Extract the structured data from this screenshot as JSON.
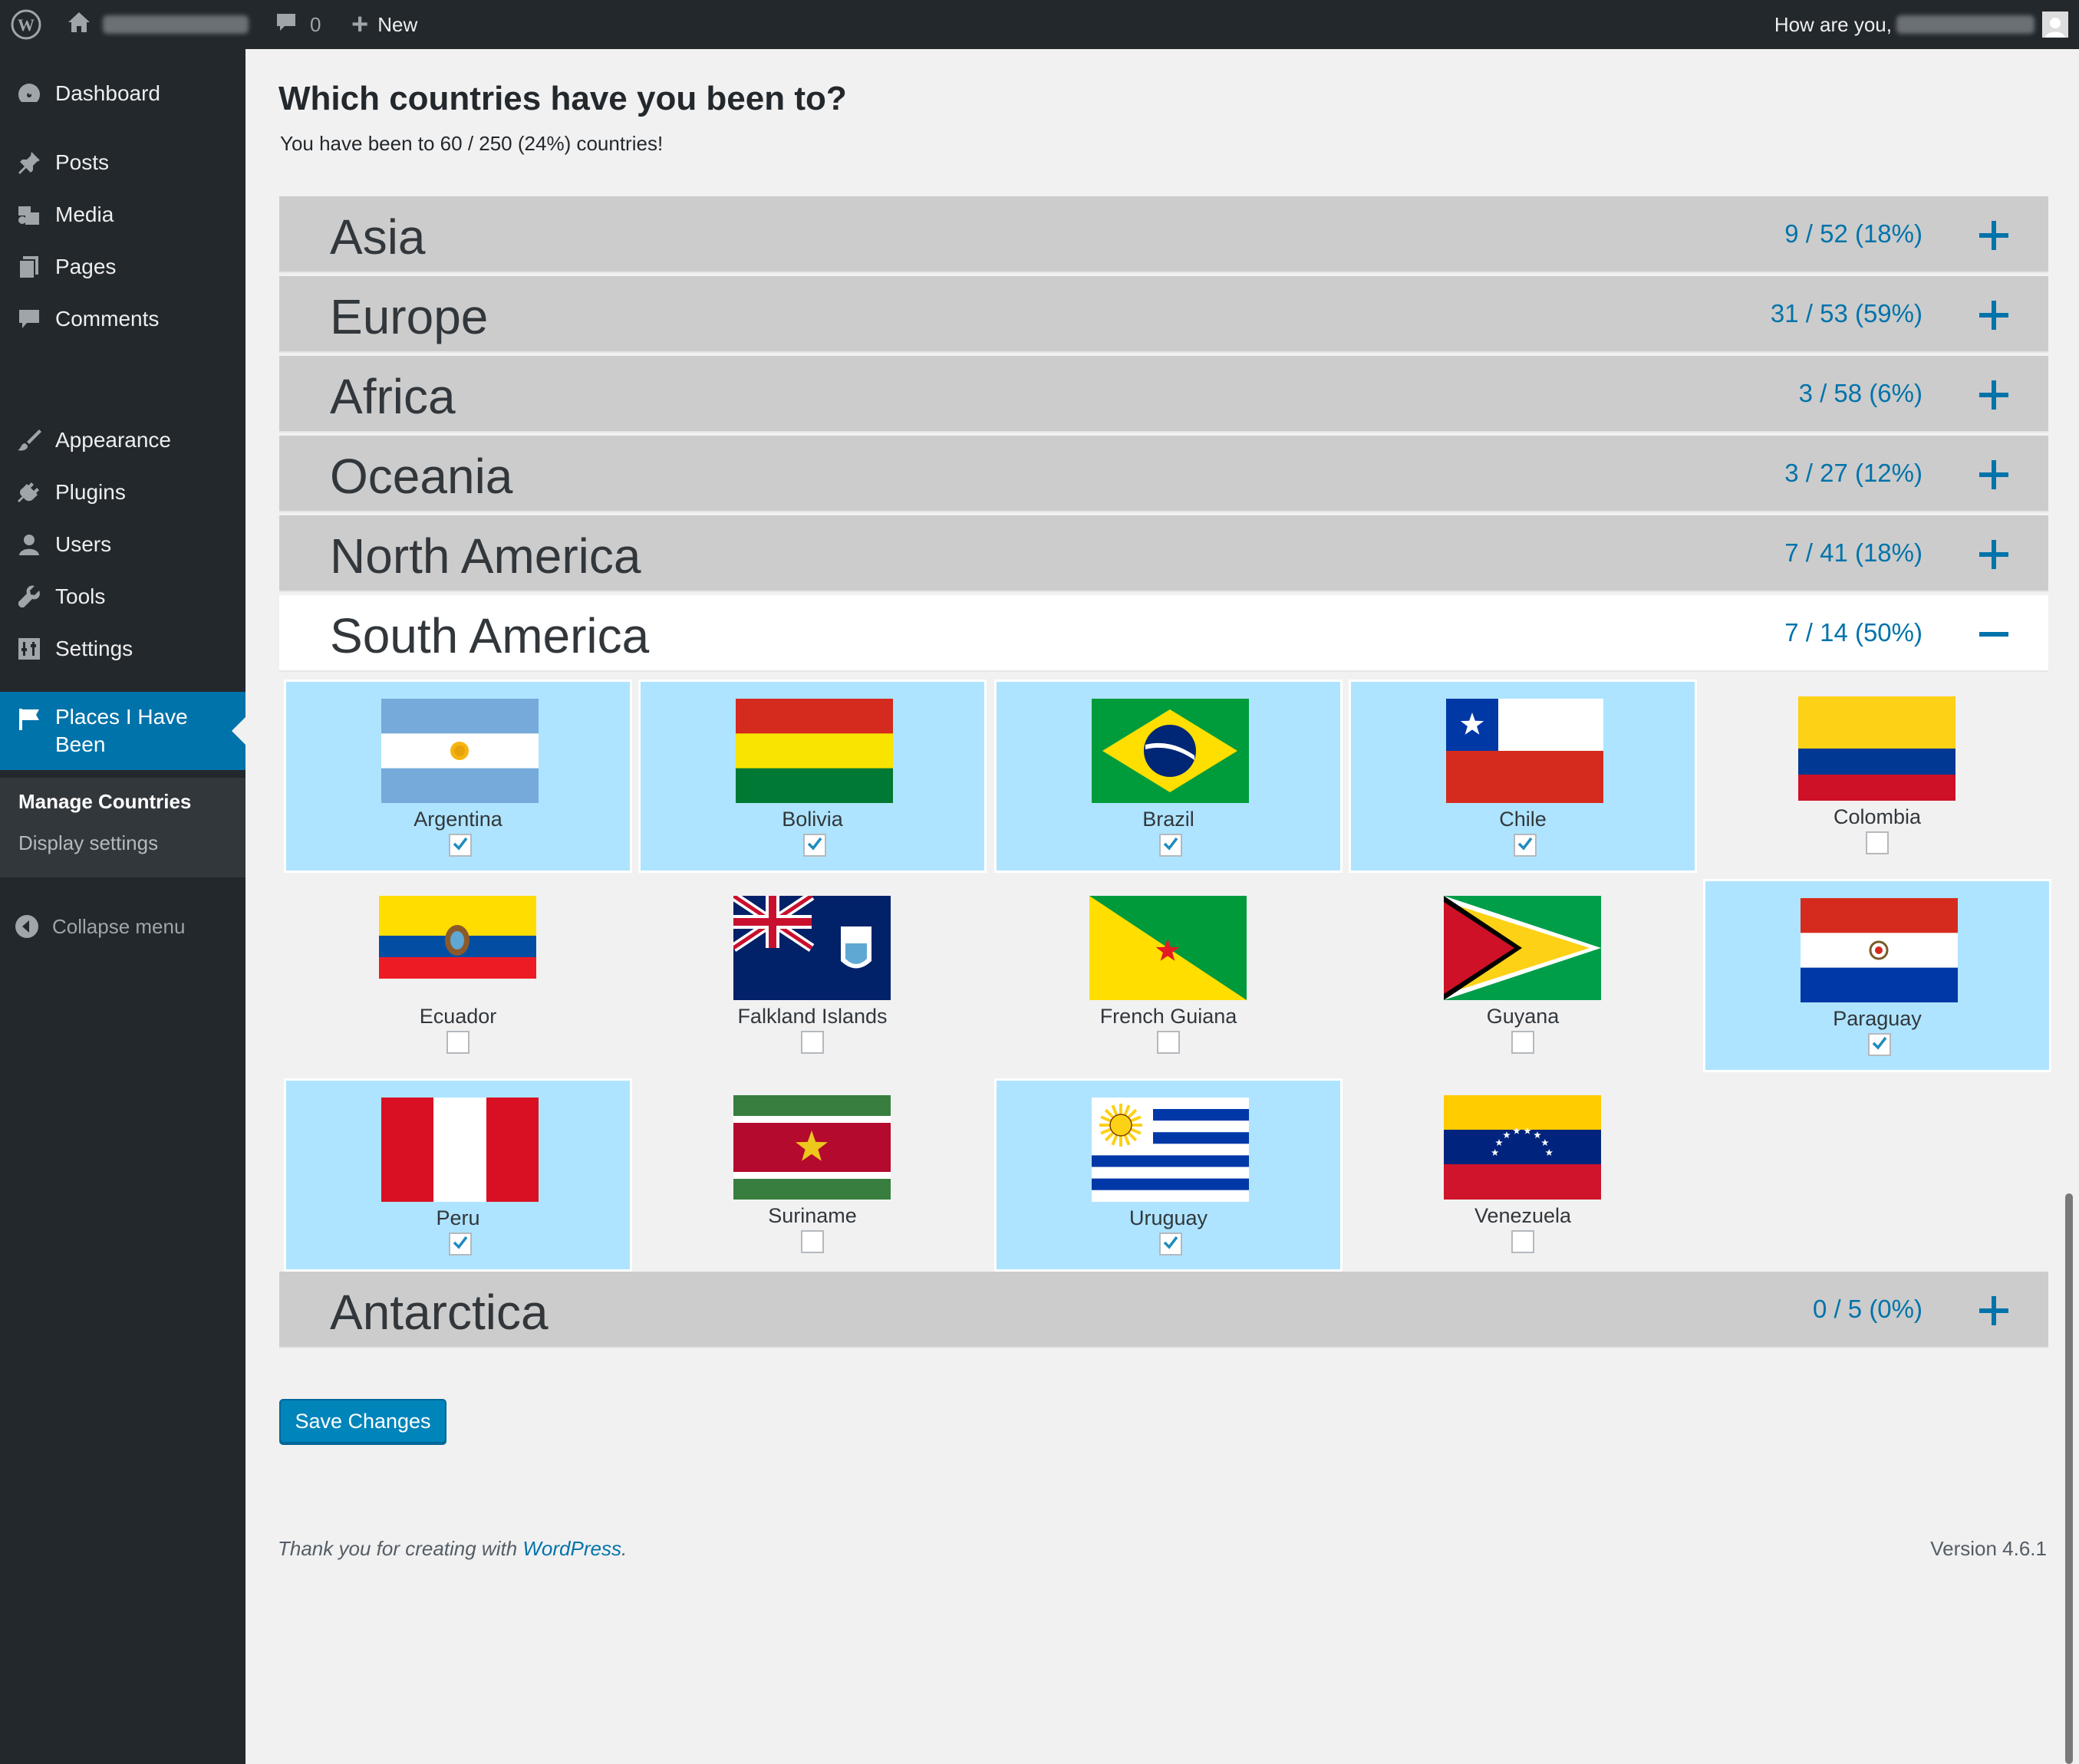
{
  "adminbar": {
    "comments_count": "0",
    "new_label": "New",
    "greeting": "How are you,"
  },
  "sidebar": {
    "items": [
      {
        "label": "Dashboard",
        "icon": "dashboard-icon"
      },
      {
        "label": "Posts",
        "icon": "pin-icon"
      },
      {
        "label": "Media",
        "icon": "media-icon"
      },
      {
        "label": "Pages",
        "icon": "pages-icon"
      },
      {
        "label": "Comments",
        "icon": "comment-icon"
      },
      {
        "label": "Appearance",
        "icon": "brush-icon"
      },
      {
        "label": "Plugins",
        "icon": "plug-icon"
      },
      {
        "label": "Users",
        "icon": "user-icon"
      },
      {
        "label": "Tools",
        "icon": "wrench-icon"
      },
      {
        "label": "Settings",
        "icon": "settings-icon"
      }
    ],
    "current": {
      "label_line1": "Places I Have",
      "label_line2": "Been",
      "icon": "flag-icon"
    },
    "submenu": [
      "Manage Countries",
      "Display settings"
    ],
    "collapse_label": "Collapse menu"
  },
  "main": {
    "title": "Which countries have you been to?",
    "summary": "You have been to 60 / 250 (24%) countries!",
    "continents": [
      {
        "name": "Asia",
        "count": "9 / 52 (18%)",
        "open": false
      },
      {
        "name": "Europe",
        "count": "31 / 53 (59%)",
        "open": false
      },
      {
        "name": "Africa",
        "count": "3 / 58 (6%)",
        "open": false
      },
      {
        "name": "Oceania",
        "count": "3 / 27 (12%)",
        "open": false
      },
      {
        "name": "North America",
        "count": "7 / 41 (18%)",
        "open": false
      },
      {
        "name": "South America",
        "count": "7 / 14 (50%)",
        "open": true
      },
      {
        "name": "Antarctica",
        "count": "0 / 5 (0%)",
        "open": false
      }
    ],
    "countries": [
      {
        "name": "Argentina",
        "visited": true
      },
      {
        "name": "Bolivia",
        "visited": true
      },
      {
        "name": "Brazil",
        "visited": true
      },
      {
        "name": "Chile",
        "visited": true
      },
      {
        "name": "Colombia",
        "visited": false
      },
      {
        "name": "Ecuador",
        "visited": false
      },
      {
        "name": "Falkland Islands",
        "visited": false
      },
      {
        "name": "French Guiana",
        "visited": false
      },
      {
        "name": "Guyana",
        "visited": false
      },
      {
        "name": "Paraguay",
        "visited": true
      },
      {
        "name": "Peru",
        "visited": true
      },
      {
        "name": "Suriname",
        "visited": false
      },
      {
        "name": "Uruguay",
        "visited": true
      },
      {
        "name": "Venezuela",
        "visited": false
      }
    ],
    "save_label": "Save Changes"
  },
  "footer": {
    "thanks_prefix": "Thank you for creating with",
    "thanks_link": "WordPress",
    "thanks_suffix": ".",
    "version": "Version 4.6.1"
  },
  "colors": {
    "accent": "#0073aa",
    "visited_bg": "#aee4ff",
    "sidebar_bg": "#23282d",
    "collapsed_bar": "#cccccc"
  }
}
